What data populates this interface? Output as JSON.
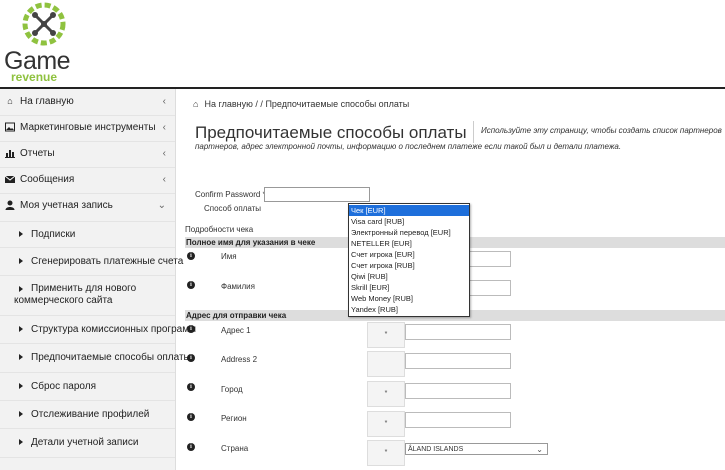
{
  "logo": {
    "line1": "Game",
    "line2": "revenue",
    "accent": "#8fc23f"
  },
  "sidebar": {
    "items": [
      {
        "label": "На главную",
        "icon": "home-icon"
      },
      {
        "label": "Маркетинговые инструменты",
        "icon": "image-icon"
      },
      {
        "label": "Отчеты",
        "icon": "bar-chart-icon"
      },
      {
        "label": "Сообщения",
        "icon": "envelope-icon"
      },
      {
        "label": "Моя учетная запись",
        "icon": "user-icon"
      }
    ],
    "subitems": [
      {
        "label": "Подписки"
      },
      {
        "label": "Сгенерировать платежные счета"
      },
      {
        "label": "Применить для нового коммерческого сайта"
      },
      {
        "label": "Структура комиссионных программ"
      },
      {
        "label": "Предпочитаемые способы оплаты"
      },
      {
        "label": "Сброс пароля"
      },
      {
        "label": "Отслеживание профилей"
      },
      {
        "label": "Детали учетной записи"
      }
    ]
  },
  "breadcrumb": {
    "home": "На главную",
    "sep1": "/",
    "sep2": "/",
    "current": "Предпочитаемые способы оплаты"
  },
  "page": {
    "title": "Предпочитаемые способы оплаты",
    "desc_line1": "Используйте эту страницу, чтобы создать список партнеров",
    "desc_line2": "партнеров, адрес электронной почты, информацию о последнем платеже если такой был и детали платежа."
  },
  "form": {
    "confirm_password_label": "Confirm Password *",
    "payment_method_label": "Способ оплаты",
    "check_details_label": "Подробности чека",
    "section_fullname": "Полное имя для указания в чеке",
    "section_address": "Адрес для отправки чека",
    "name_label": "Имя",
    "surname_label": "Фамилия",
    "address1_label": "Адрес 1",
    "address2_label": "Address 2",
    "city_label": "Город",
    "region_label": "Регион",
    "country_label": "Страна",
    "required_mark": "*",
    "info_glyph": "i",
    "country_value": "ÅLAND ISLANDS"
  },
  "payment_options": [
    "Чек [EUR]",
    "Visa card [RUB]",
    "Электронный перевод [EUR]",
    "NETELLER [EUR]",
    "Счет игрока [EUR]",
    "Счет игрока [RUB]",
    "Qiwi [RUB]",
    "Skrill [EUR]",
    "Web Money [RUB]",
    "Yandex [RUB]"
  ],
  "colors": {
    "selected_option": "#1e6fdb",
    "section_header_bg": "#dddddd",
    "sidebar_bg": "#f2f2f2"
  }
}
